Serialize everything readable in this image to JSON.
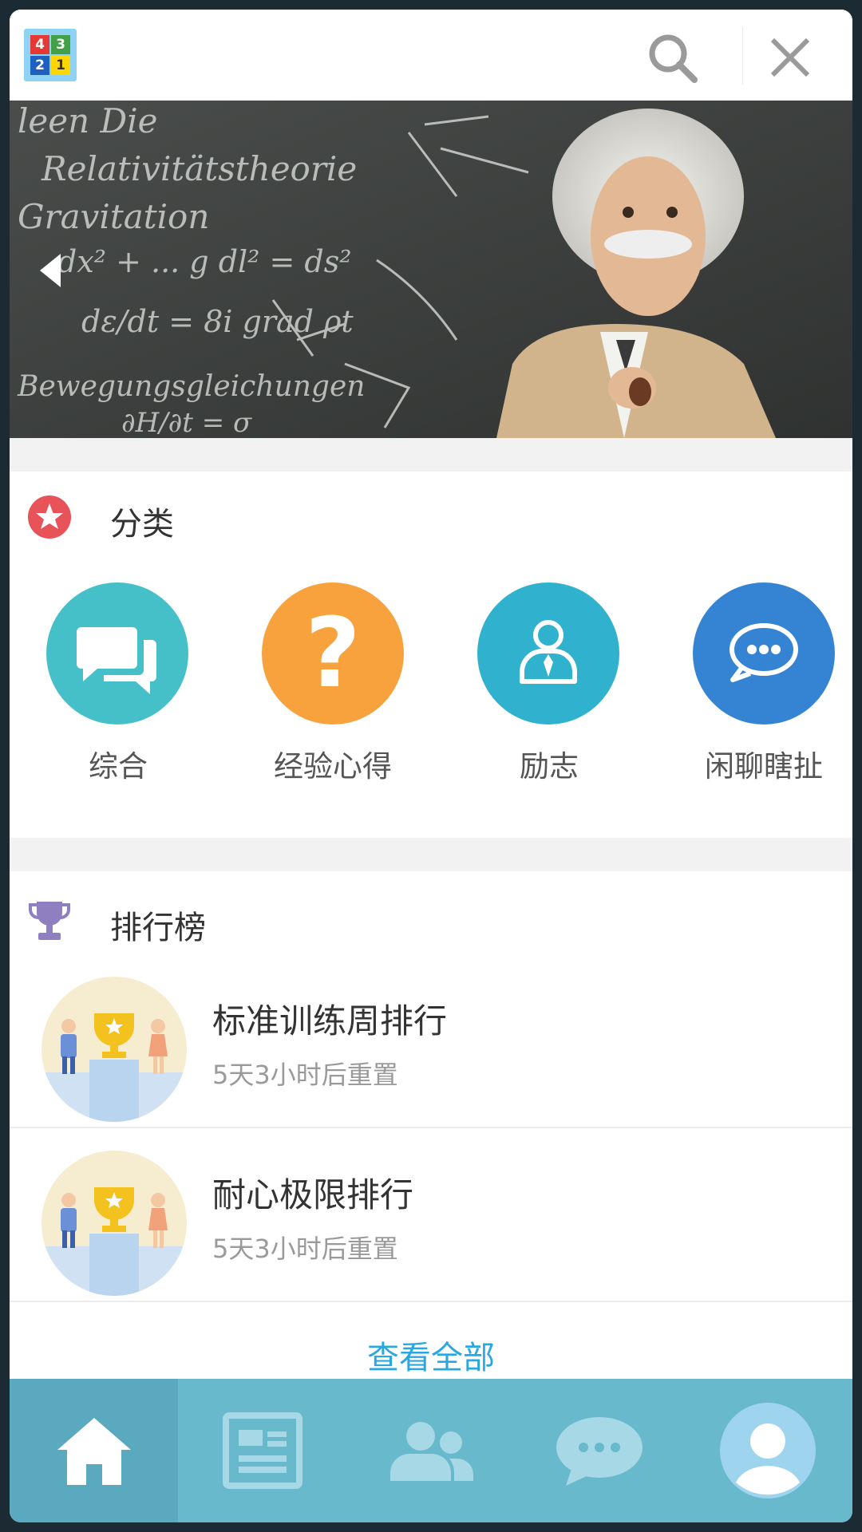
{
  "header": {
    "logo_digits": [
      "4",
      "3",
      "2",
      "1"
    ],
    "logo_colors": [
      "#e53935",
      "#43a047",
      "#1e5fbf",
      "#ffd600"
    ],
    "search_icon": "search-icon",
    "close_icon": "close-icon"
  },
  "banner": {
    "prev_icon": "chevron-left-icon",
    "chalk_lines": [
      "leen Die",
      "Relativitätstheorie",
      "Gravitation",
      "dx² + ... g dl² = ds²",
      "dε/dt = 8i grad ρt",
      "Bewegungsgleichungen",
      "∂H/∂t = σ"
    ]
  },
  "categories": {
    "title": "分类",
    "title_icon": "star-icon",
    "items": [
      {
        "label": "综合",
        "icon": "chat-bubbles-icon",
        "color": "#45c0c8"
      },
      {
        "label": "经验心得",
        "icon": "question-icon",
        "color": "#f7a23d"
      },
      {
        "label": "励志",
        "icon": "person-tie-icon",
        "color": "#30b2cf"
      },
      {
        "label": "闲聊瞎扯",
        "icon": "speech-dots-icon",
        "color": "#3584d3"
      }
    ]
  },
  "ranking": {
    "title": "排行榜",
    "title_icon": "trophy-icon",
    "items": [
      {
        "title": "标准训练周排行",
        "subtitle": "5天3小时后重置"
      },
      {
        "title": "耐心极限排行",
        "subtitle": "5天3小时后重置"
      }
    ],
    "view_all": "查看全部"
  },
  "bottom_nav": {
    "items": [
      {
        "icon": "home-icon",
        "active": true
      },
      {
        "icon": "news-icon",
        "active": false
      },
      {
        "icon": "people-icon",
        "active": false
      },
      {
        "icon": "messages-icon",
        "active": false
      },
      {
        "icon": "avatar-icon",
        "active": false
      }
    ]
  }
}
